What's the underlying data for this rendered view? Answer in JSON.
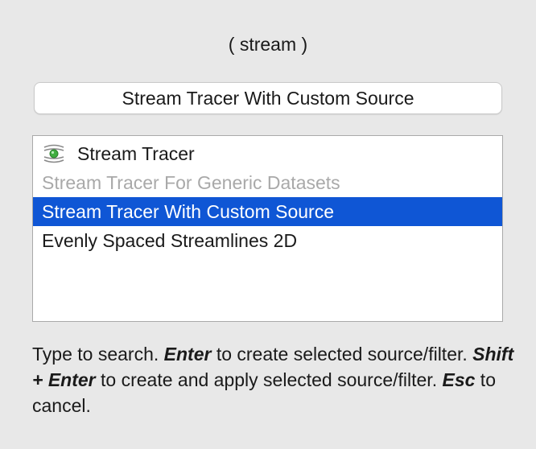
{
  "query": "( stream )",
  "search": {
    "value": "Stream Tracer With Custom Source"
  },
  "list": {
    "items": [
      {
        "label": "Stream Tracer",
        "icon": "stream-tracer-icon",
        "state": "normal"
      },
      {
        "label": "Stream Tracer For Generic Datasets",
        "state": "disabled"
      },
      {
        "label": "Stream Tracer With Custom Source",
        "state": "selected"
      },
      {
        "label": "Evenly Spaced Streamlines 2D",
        "state": "normal"
      }
    ]
  },
  "help": {
    "part1": "Type to search. ",
    "key_enter": "Enter",
    "part2": " to create selected source/filter. ",
    "key_shift_enter": "Shift + Enter",
    "part3": " to create and apply selected source/filter. ",
    "key_esc": "Esc",
    "part4": " to cancel."
  },
  "colors": {
    "selection": "#0f56d5",
    "disabled_text": "#a9a9a9",
    "icon_green": "#3fae3f"
  }
}
